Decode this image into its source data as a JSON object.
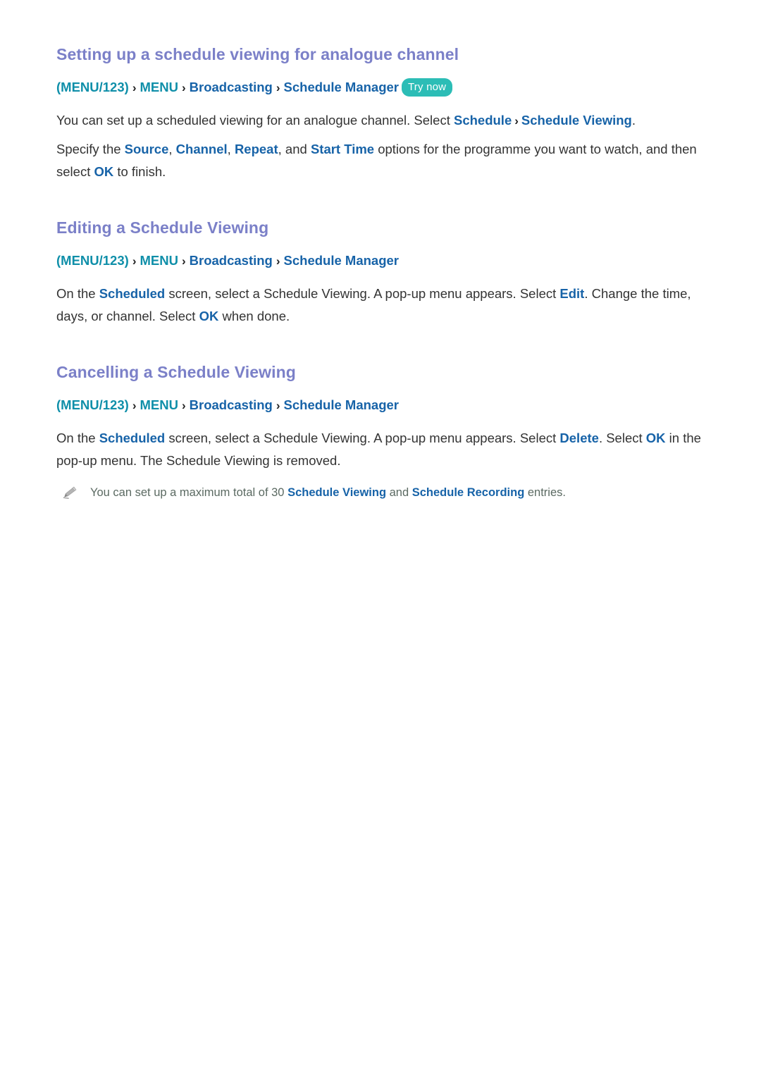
{
  "colors": {
    "heading": "#7b80c8",
    "link_blue": "#1763a8",
    "teal": "#0f8fa9",
    "badge_teal": "#2cbdb6",
    "body_text": "#333333",
    "note_text": "#5b6a62",
    "arrow": "#222222",
    "background": "#ffffff"
  },
  "icons": {
    "pencil": "pencil-icon",
    "chevron": "chevron-right-icon"
  },
  "sections": [
    {
      "heading": "Setting up a schedule viewing for analogue channel",
      "path": {
        "menu123": "(MENU/123)",
        "arrow1": "›",
        "menu": "MENU",
        "arrow2": "›",
        "broadcasting": "Broadcasting",
        "arrow3": "›",
        "schedule_manager": "Schedule Manager",
        "badge": "Try now"
      },
      "paragraphs": [
        {
          "p1": "You can set up a scheduled viewing for an analogue channel. Select ",
          "l1": "Schedule",
          "arrow": "›",
          "l2": "Schedule Viewing",
          "p2": "."
        },
        {
          "p1": "Specify the ",
          "l1": "Source",
          "p2": ", ",
          "l2": "Channel",
          "p3": ", ",
          "l3": "Repeat",
          "p4": ", and ",
          "l4": "Start Time",
          "p5": " options for the programme you want to watch, and then select ",
          "l5": "OK",
          "p6": " to finish."
        }
      ]
    },
    {
      "heading": "Editing a Schedule Viewing",
      "path": {
        "menu123": "(MENU/123)",
        "arrow1": "›",
        "menu": "MENU",
        "arrow2": "›",
        "broadcasting": "Broadcasting",
        "arrow3": "›",
        "schedule_manager": "Schedule Manager",
        "badge": ""
      },
      "paragraph": {
        "p1": "On the ",
        "l1": "Scheduled",
        "p2": " screen, select a Schedule Viewing. A pop-up menu appears. Select ",
        "l2": "Edit",
        "p3": ". Change the time, days, or channel. Select ",
        "l3": "OK",
        "p4": " when done."
      }
    },
    {
      "heading": "Cancelling a Schedule Viewing",
      "path": {
        "menu123": "(MENU/123)",
        "arrow1": "›",
        "menu": "MENU",
        "arrow2": "›",
        "broadcasting": "Broadcasting",
        "arrow3": "›",
        "schedule_manager": "Schedule Manager",
        "badge": ""
      },
      "paragraph": {
        "p1": "On the ",
        "l1": "Scheduled",
        "p2": " screen, select a Schedule Viewing. A pop-up menu appears. Select ",
        "l2": "Delete",
        "p3": ". Select ",
        "l3": "OK",
        "p4": " in the pop-up menu. The Schedule Viewing is removed."
      },
      "note": {
        "p1": "You can set up a maximum total of 30 ",
        "l1": "Schedule Viewing",
        "p2": " and ",
        "l2": "Schedule Recording",
        "p3": " entries."
      }
    }
  ]
}
